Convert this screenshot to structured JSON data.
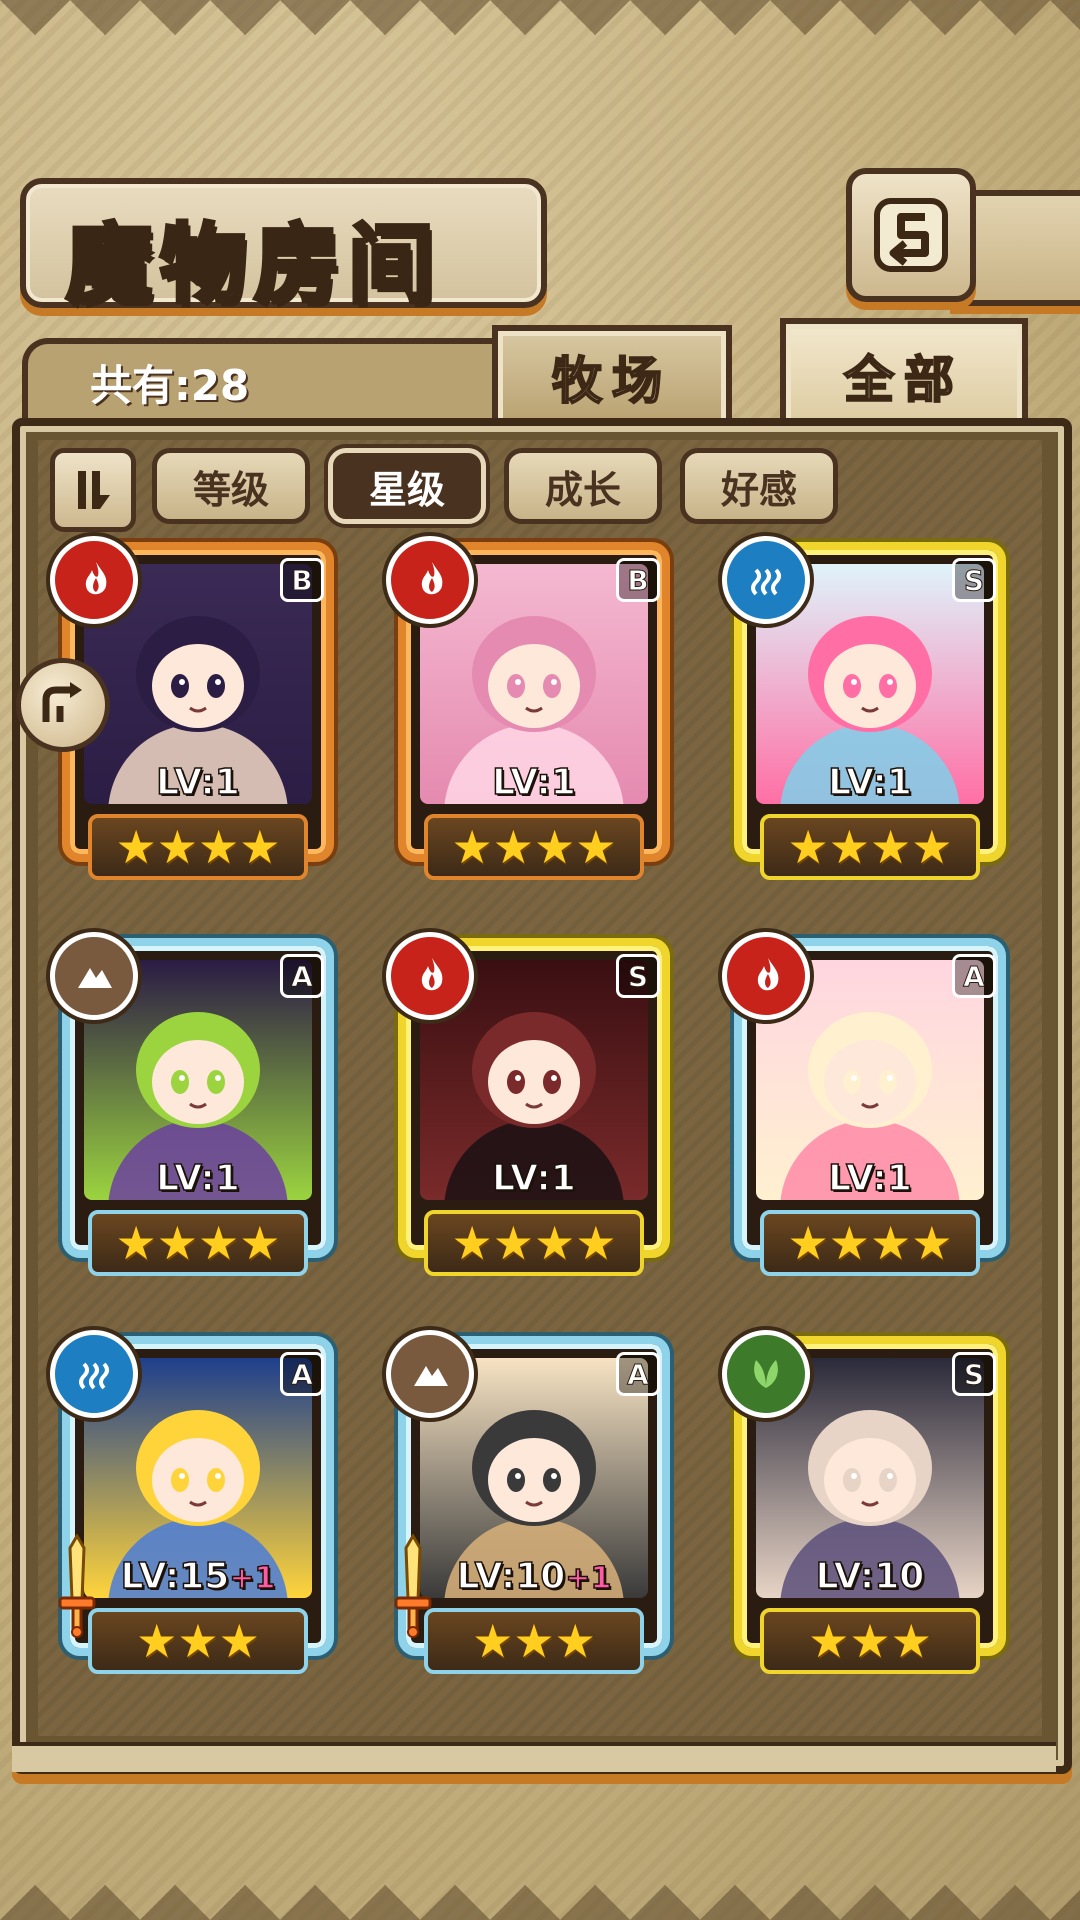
{
  "header": {
    "title": "魔物房间",
    "back_icon": "return-arrow-icon"
  },
  "summary": {
    "count_text": "共有:28"
  },
  "tabs": [
    {
      "label": "牧场",
      "active": false
    },
    {
      "label": "全部",
      "active": true
    }
  ],
  "sort": {
    "toggle_icon": "sort-order-icon",
    "options": [
      {
        "label": "等级",
        "active": false
      },
      {
        "label": "星级",
        "active": true
      },
      {
        "label": "成长",
        "active": false
      },
      {
        "label": "好感",
        "active": false
      }
    ]
  },
  "side_arrow_icon": "rotate-arrow-icon",
  "monsters": [
    {
      "rank": "B",
      "element": "fire",
      "level": "LV:1",
      "bonus": "",
      "stars": 4,
      "has_weapon": false
    },
    {
      "rank": "B",
      "element": "fire",
      "level": "LV:1",
      "bonus": "",
      "stars": 4,
      "has_weapon": false
    },
    {
      "rank": "S",
      "element": "water",
      "level": "LV:1",
      "bonus": "",
      "stars": 4,
      "has_weapon": false
    },
    {
      "rank": "A",
      "element": "earth",
      "level": "LV:1",
      "bonus": "",
      "stars": 4,
      "has_weapon": false
    },
    {
      "rank": "S",
      "element": "fire",
      "level": "LV:1",
      "bonus": "",
      "stars": 4,
      "has_weapon": false
    },
    {
      "rank": "A",
      "element": "fire",
      "level": "LV:1",
      "bonus": "",
      "stars": 4,
      "has_weapon": false
    },
    {
      "rank": "A",
      "element": "water",
      "level": "LV:15",
      "bonus": "+1",
      "stars": 3,
      "has_weapon": true
    },
    {
      "rank": "A",
      "element": "earth",
      "level": "LV:10",
      "bonus": "+1",
      "stars": 3,
      "has_weapon": true
    },
    {
      "rank": "S",
      "element": "wood",
      "level": "LV:10",
      "bonus": "",
      "stars": 3,
      "has_weapon": false
    }
  ],
  "colors": {
    "rank_B": "#e0852c",
    "rank_S": "#f0d52c",
    "rank_A": "#8fd3ea",
    "star": "#ffce1f",
    "bonus": "#ff5aa5"
  }
}
